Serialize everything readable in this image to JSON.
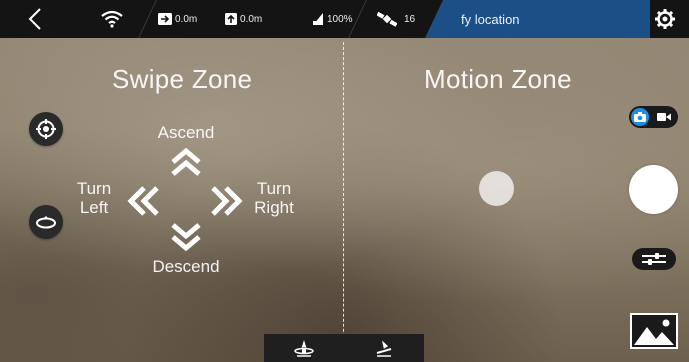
{
  "topbar": {
    "distance": "0.0m",
    "altitude": "0.0m",
    "battery": "100%",
    "satellites": "16",
    "location_tab": "fy location"
  },
  "swipe_zone": {
    "title": "Swipe Zone",
    "ascend": "Ascend",
    "descend": "Descend",
    "turn_left_1": "Turn",
    "turn_left_2": "Left",
    "turn_right_1": "Turn",
    "turn_right_2": "Right"
  },
  "motion_zone": {
    "title": "Motion Zone"
  },
  "colors": {
    "topbar_bg": "#141414",
    "location_tab_bg": "#1c4f86",
    "camera_mode_active": "#1d8fe0"
  },
  "icons": {
    "back": "back-chevron-icon",
    "wifi": "wifi-icon",
    "distance": "arrow-right-icon",
    "altitude": "arrow-up-icon",
    "battery": "battery-icon",
    "satellite": "satellite-icon",
    "settings": "gear-icon",
    "gps_target": "crosshair-icon",
    "circle_flight": "orbit-icon",
    "camera": "camera-icon",
    "video": "video-icon",
    "adjust": "sliders-icon",
    "gallery": "gallery-icon",
    "takeoff": "takeoff-icon",
    "land": "landing-icon"
  }
}
